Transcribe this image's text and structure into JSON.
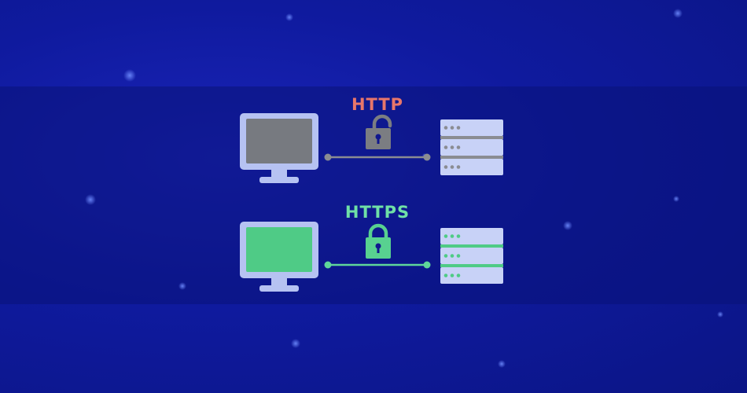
{
  "connections": {
    "http": {
      "label": "HTTP",
      "label_color": "#e8766a",
      "screen_color": "#777a80",
      "line_color": "#8a8c92",
      "lock_color": "#7b7d82",
      "lock_state": "unlocked",
      "server_accent": "#8a8c92"
    },
    "https": {
      "label": "HTTPS",
      "label_color": "#6fe0a6",
      "screen_color": "#4fcb86",
      "line_color": "#5fd69a",
      "lock_color": "#58d190",
      "lock_state": "locked",
      "server_accent": "#4fcb86"
    }
  },
  "colors": {
    "background": "#0f1a9e",
    "device": "#b6c2f2",
    "server_panel": "#c8d2f7"
  },
  "icons": {
    "client": "monitor-icon",
    "server": "server-rack-icon",
    "http_lock": "unlocked-padlock-icon",
    "https_lock": "locked-padlock-icon"
  }
}
